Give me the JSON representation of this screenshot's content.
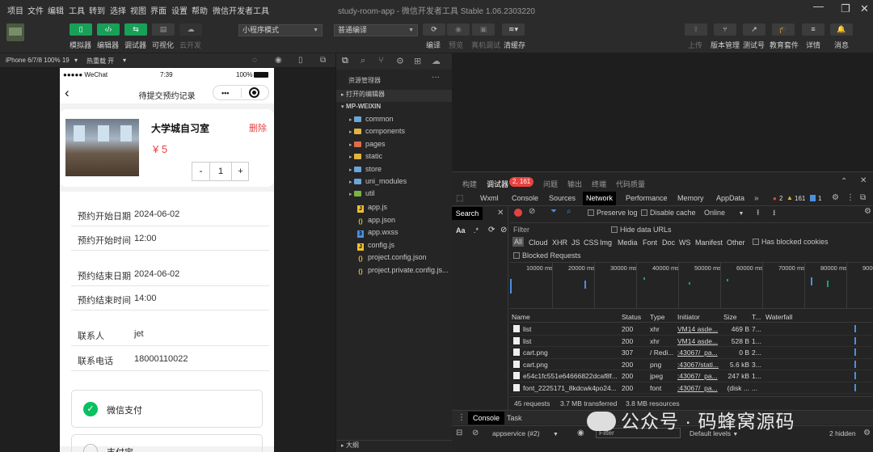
{
  "menu": [
    "项目",
    "文件",
    "编辑",
    "工具",
    "转到",
    "选择",
    "视图",
    "界面",
    "设置",
    "帮助",
    "微信开发者工具"
  ],
  "window_title": "study-room-app - 微信开发者工具 Stable 1.06.2303220",
  "toolbar": {
    "left_buttons": [
      "模拟器",
      "编辑器",
      "调试器",
      "可视化",
      "云开发"
    ],
    "mode_select": "小程序模式",
    "compile_select": "普通编译",
    "mid_labels": [
      "编译",
      "预览",
      "真机调试",
      "清缓存"
    ],
    "right_labels": [
      "上传",
      "版本管理",
      "测试号",
      "教育套件",
      "详情",
      "消息"
    ]
  },
  "simulator_bar": {
    "device": "iPhone 6/7/8 100% 19",
    "hot_reload": "热重载 开"
  },
  "phone": {
    "status_left": "●●●●● WeChat",
    "status_time": "7:39",
    "status_right": "100%",
    "nav_title": "待提交预约记录",
    "nav_more": "•••",
    "room_name": "大学城自习室",
    "price": "¥ 5",
    "delete": "删除",
    "qty": "1",
    "minus": "-",
    "plus": "+",
    "rows": [
      {
        "label": "预约开始日期",
        "value": "2024-06-02"
      },
      {
        "label": "预约开始时间",
        "value": "12:00"
      },
      {
        "label": "预约结束日期",
        "value": "2024-06-02"
      },
      {
        "label": "预约结束时间",
        "value": "14:00"
      },
      {
        "label": "联系人",
        "value": "jet"
      },
      {
        "label": "联系电话",
        "value": "18000110022"
      }
    ],
    "pay_wechat": "微信支付",
    "pay_other": "支付宝"
  },
  "explorer": {
    "header": "资源管理器",
    "open_editors": "打开的编辑器",
    "project": "MP-WEIXIN",
    "folders": [
      {
        "name": "common",
        "color": "#6aa6d6"
      },
      {
        "name": "components",
        "color": "#e0b440"
      },
      {
        "name": "pages",
        "color": "#e06c4c"
      },
      {
        "name": "static",
        "color": "#e0b440"
      },
      {
        "name": "store",
        "color": "#6aa6d6"
      },
      {
        "name": "uni_modules",
        "color": "#6aa6d6"
      },
      {
        "name": "util",
        "color": "#7cb342"
      }
    ],
    "files": [
      {
        "name": "app.js",
        "kind": "js"
      },
      {
        "name": "app.json",
        "kind": "json"
      },
      {
        "name": "app.wxss",
        "kind": "wxss"
      },
      {
        "name": "config.js",
        "kind": "js"
      },
      {
        "name": "project.config.json",
        "kind": "json"
      },
      {
        "name": "project.private.config.js...",
        "kind": "json"
      }
    ],
    "outline": "大纲"
  },
  "devtools": {
    "top_tabs": [
      "构建",
      "调试器",
      "问题",
      "输出",
      "终端",
      "代码质量"
    ],
    "error_badge": "2, 161",
    "panel_tabs": [
      "Wxml",
      "Console",
      "Sources",
      "Network",
      "Performance",
      "Memory",
      "AppData"
    ],
    "errors": "2",
    "warnings": "161",
    "info": "1",
    "search_label": "Search",
    "preserve_log": "Preserve log",
    "disable_cache": "Disable cache",
    "throttle": "Online",
    "filter_placeholder": "Filter",
    "hide_data_urls": "Hide data URLs",
    "types": [
      "All",
      "Cloud",
      "XHR",
      "JS",
      "CSS",
      "Img",
      "Media",
      "Font",
      "Doc",
      "WS",
      "Manifest",
      "Other"
    ],
    "has_blocked_cookies": "Has blocked cookies",
    "blocked_requests": "Blocked Requests",
    "timeline_ticks": [
      "10000 ms",
      "20000 ms",
      "30000 ms",
      "40000 ms",
      "50000 ms",
      "60000 ms",
      "70000 ms",
      "80000 ms",
      "9000"
    ],
    "columns": [
      "Name",
      "Status",
      "Type",
      "Initiator",
      "Size",
      "T...",
      "Waterfall"
    ],
    "rows": [
      {
        "name": "list",
        "status": "200",
        "type": "xhr",
        "initiator": "VM14 asde...",
        "size": "469 B",
        "time": "7..."
      },
      {
        "name": "list",
        "status": "200",
        "type": "xhr",
        "initiator": "VM14 asde...",
        "size": "528 B",
        "time": "1..."
      },
      {
        "name": "cart.png",
        "status": "307",
        "type": "/ Redi...",
        "initiator": ":43067/_pa...",
        "size": "0 B",
        "time": "2..."
      },
      {
        "name": "cart.png",
        "status": "200",
        "type": "png",
        "initiator": ":43067/stati...",
        "size": "5.6 kB",
        "time": "3..."
      },
      {
        "name": "e54c1fc551e64666822dcaf8f...",
        "status": "200",
        "type": "jpeg",
        "initiator": ":43067/_pa...",
        "size": "247 kB",
        "time": "1..."
      },
      {
        "name": "font_2225171_8kdcwk4po24...",
        "status": "200",
        "type": "font",
        "initiator": ":43067/_pa...",
        "size": "(disk ...",
        "time": "..."
      }
    ],
    "summary": [
      "45 requests",
      "3.7 MB transferred",
      "3.8 MB resources"
    ],
    "drawer_tabs": [
      "Console",
      "Task"
    ],
    "context": "appservice (#2)",
    "console_filter": "Filter",
    "levels": "Default levels",
    "hidden": "2 hidden"
  },
  "watermark": "公众号 · 码蜂窝源码"
}
